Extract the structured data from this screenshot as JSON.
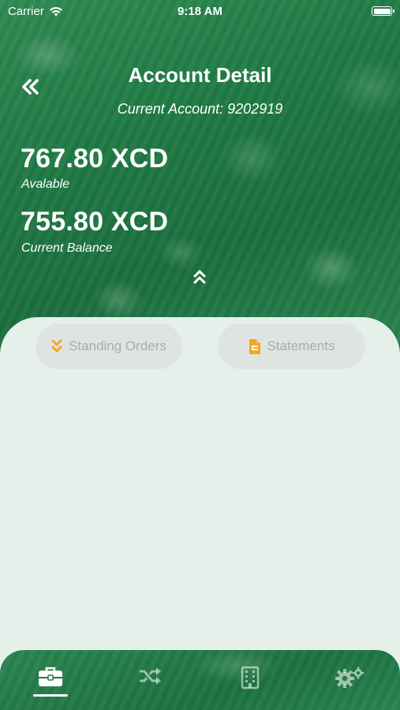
{
  "status_bar": {
    "carrier": "Carrier",
    "time": "9:18 AM"
  },
  "header": {
    "title": "Account Detail",
    "account_line": "Current Account: 9202919"
  },
  "balances": {
    "available_amount": "767.80 XCD",
    "available_label": "Avalable",
    "current_amount": "755.80 XCD",
    "current_label": "Current Balance"
  },
  "actions": {
    "standing_orders_label": "Standing Orders",
    "statements_label": "Statements"
  },
  "tabbar": {
    "tabs": [
      {
        "icon": "briefcase-icon",
        "active": true
      },
      {
        "icon": "shuffle-icon",
        "active": false
      },
      {
        "icon": "building-icon",
        "active": false
      },
      {
        "icon": "gears-icon",
        "active": false
      }
    ]
  },
  "colors": {
    "header_green": "#1f7a44",
    "card_background": "#e6f0ea",
    "pill_background": "#dfe4e1",
    "pill_text": "#a8acaa",
    "accent_orange": "#f5a623"
  }
}
